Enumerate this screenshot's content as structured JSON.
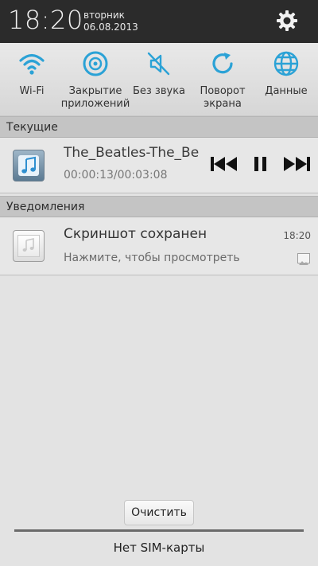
{
  "header": {
    "time": "18:20",
    "day": "вторник",
    "date": "06.08.2013",
    "settings_icon": "gear-icon"
  },
  "toggles": [
    {
      "label": "Wi-Fi",
      "icon": "wifi-icon"
    },
    {
      "label": "Закрытие приложений",
      "icon": "close-apps-icon"
    },
    {
      "label": "Без звука",
      "icon": "mute-icon"
    },
    {
      "label": "Поворот экрана",
      "icon": "rotate-icon"
    },
    {
      "label": "Данные",
      "icon": "globe-icon"
    }
  ],
  "sections": {
    "current": "Текущие",
    "notifications": "Уведомления"
  },
  "media": {
    "title": "The_Beatles-The_Be",
    "elapsed_total": "00:00:13/00:03:08",
    "icon": "music-note-icon"
  },
  "notification": {
    "title": "Скриншот сохранен",
    "subtitle": "Нажмите, чтобы просмотреть",
    "time": "18:20",
    "icon": "music-note-icon",
    "small_icon": "image-icon"
  },
  "footer": {
    "clear_label": "Очистить",
    "sim_status": "Нет SIM-карты"
  },
  "colors": {
    "toggle_accent": "#2ba2d6",
    "header_bg": "#2b2b2b"
  }
}
